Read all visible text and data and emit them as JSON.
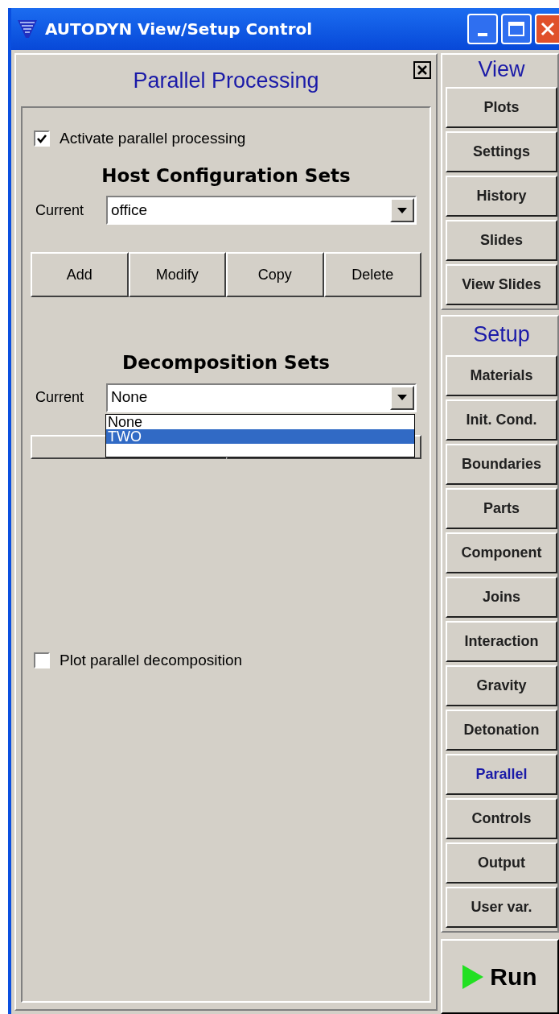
{
  "window": {
    "title": "AUTODYN View/Setup Control"
  },
  "panel": {
    "title": "Parallel Processing",
    "activate": {
      "label": "Activate parallel processing",
      "checked": true
    },
    "host_sets": {
      "heading": "Host Configuration Sets",
      "current_label": "Current",
      "value": "office",
      "buttons": [
        "Add",
        "Modify",
        "Copy",
        "Delete"
      ]
    },
    "decomposition_sets": {
      "heading": "Decomposition Sets",
      "current_label": "Current",
      "value": "None",
      "dropdown": {
        "expanded": true,
        "options": [
          {
            "label": "None",
            "selected": false
          },
          {
            "label": "TWO",
            "selected": true
          }
        ]
      }
    },
    "plot_decomposition": {
      "label": "Plot parallel decomposition",
      "checked": false
    }
  },
  "sidebar": {
    "view": {
      "heading": "View",
      "items": [
        {
          "label": "Plots",
          "selected": false
        },
        {
          "label": "Settings",
          "selected": false
        },
        {
          "label": "History",
          "selected": false
        },
        {
          "label": "Slides",
          "selected": false
        },
        {
          "label": "View Slides",
          "selected": false
        }
      ]
    },
    "setup": {
      "heading": "Setup",
      "items": [
        {
          "label": "Materials",
          "selected": false
        },
        {
          "label": "Init. Cond.",
          "selected": false
        },
        {
          "label": "Boundaries",
          "selected": false
        },
        {
          "label": "Parts",
          "selected": false
        },
        {
          "label": "Component",
          "selected": false
        },
        {
          "label": "Joins",
          "selected": false
        },
        {
          "label": "Interaction",
          "selected": false
        },
        {
          "label": "Gravity",
          "selected": false
        },
        {
          "label": "Detonation",
          "selected": false
        },
        {
          "label": "Parallel",
          "selected": true
        },
        {
          "label": "Controls",
          "selected": false
        },
        {
          "label": "Output",
          "selected": false
        },
        {
          "label": "User var.",
          "selected": false
        }
      ]
    },
    "run": {
      "label": "Run"
    }
  }
}
